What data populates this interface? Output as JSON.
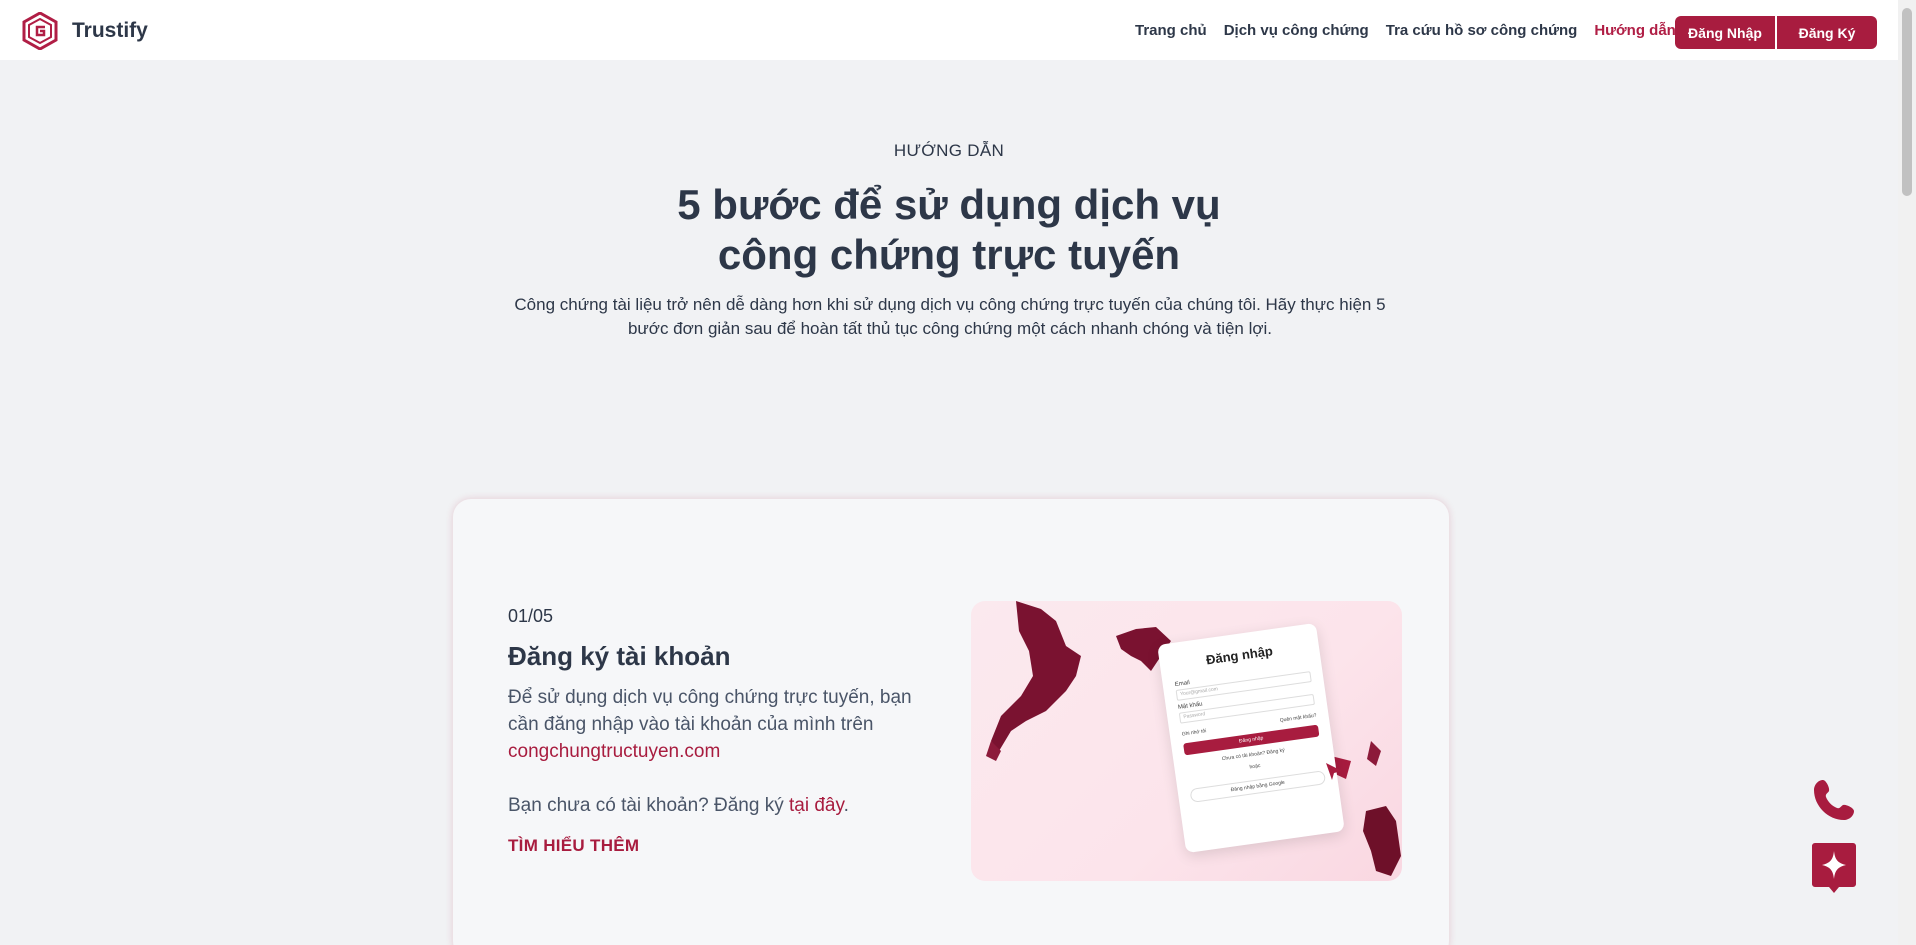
{
  "header": {
    "brand": "Trustify",
    "nav": [
      {
        "label": "Trang chủ",
        "active": false
      },
      {
        "label": "Dịch vụ công chứng",
        "active": false
      },
      {
        "label": "Tra cứu hồ sơ công chứng",
        "active": false
      },
      {
        "label": "Hướng dẫn",
        "active": true
      }
    ],
    "login_label": "Đăng Nhập",
    "register_label": "Đăng Ký"
  },
  "hero": {
    "eyebrow": "HƯỚNG DẪN",
    "title_line1": "5 bước để sử dụng dịch vụ",
    "title_line2": "công chứng trực tuyến",
    "description": "Công chứng tài liệu trở nên dễ dàng hơn khi sử dụng dịch vụ công chứng trực tuyến của chúng tôi. Hãy thực hiện 5 bước đơn giản sau để hoàn tất thủ tục công chứng một cách nhanh chóng và tiện lợi."
  },
  "step": {
    "number": "01/05",
    "title": "Đăng ký tài khoản",
    "desc_prefix": "Để sử dụng dịch vụ công chứng trực tuyến, bạn cần đăng nhập vào tài khoản của mình trên ",
    "desc_link": "congchungtructuyen.com",
    "cta_prefix": "Bạn chưa có tài khoản? Đăng ký ",
    "cta_link": "tại đây",
    "cta_suffix": ".",
    "learn_more": "TÌM HIỂU THÊM"
  },
  "mock_login": {
    "title": "Đăng nhập",
    "email_label": "Email",
    "email_placeholder": "Your@gmail.com",
    "password_label": "Mật khẩu",
    "password_placeholder": "Password",
    "remember": "Ghi nhớ tôi",
    "forgot": "Quên mật khẩu?",
    "submit": "Đăng nhập",
    "no_account": "Chưa có tài khoản? Đăng ký",
    "or": "hoặc",
    "google": "Đăng nhập bằng Google"
  },
  "icons": {
    "logo": "trustify-logo-icon",
    "phone": "phone-icon",
    "ai": "sparkle-chat-icon"
  },
  "colors": {
    "brand": "#a81c3f",
    "text": "#2d3748",
    "background": "#f1f2f4"
  }
}
